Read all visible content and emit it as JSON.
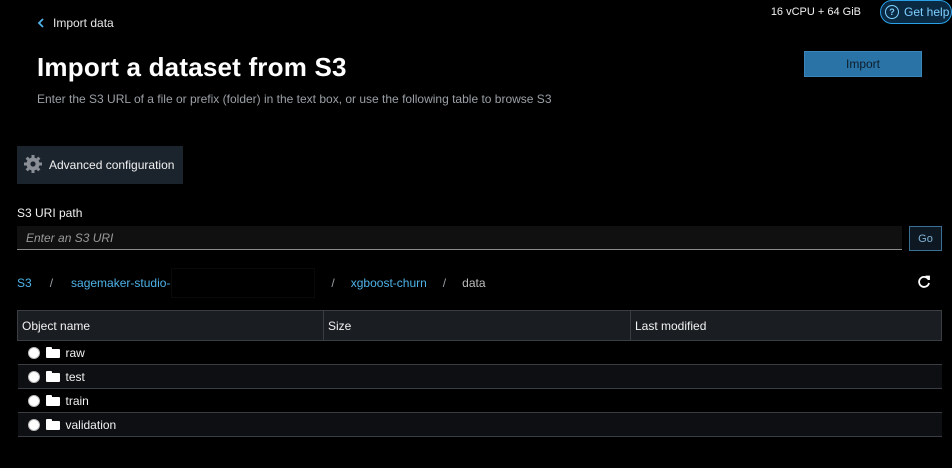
{
  "header": {
    "back_label": "Import data",
    "resources": "16 vCPU + 64 GiB",
    "help_label": "Get help"
  },
  "page": {
    "title": "Import a dataset from S3",
    "subtitle": "Enter the S3 URL of a file or prefix (folder) in the text box, or use the following table to browse S3",
    "import_label": "Import"
  },
  "advanced": {
    "label": "Advanced configuration"
  },
  "uri": {
    "label": "S3 URI path",
    "placeholder": "Enter an S3 URI",
    "go_label": "Go"
  },
  "breadcrumb": {
    "root": "S3",
    "bucket": "sagemaker-studio-",
    "folder": "xgboost-churn",
    "current": "data",
    "separator": "/"
  },
  "table": {
    "columns": [
      "Object name",
      "Size",
      "Last modified"
    ],
    "rows": [
      {
        "name": "raw",
        "size": "",
        "modified": ""
      },
      {
        "name": "test",
        "size": "",
        "modified": ""
      },
      {
        "name": "train",
        "size": "",
        "modified": ""
      },
      {
        "name": "validation",
        "size": "",
        "modified": ""
      }
    ]
  }
}
